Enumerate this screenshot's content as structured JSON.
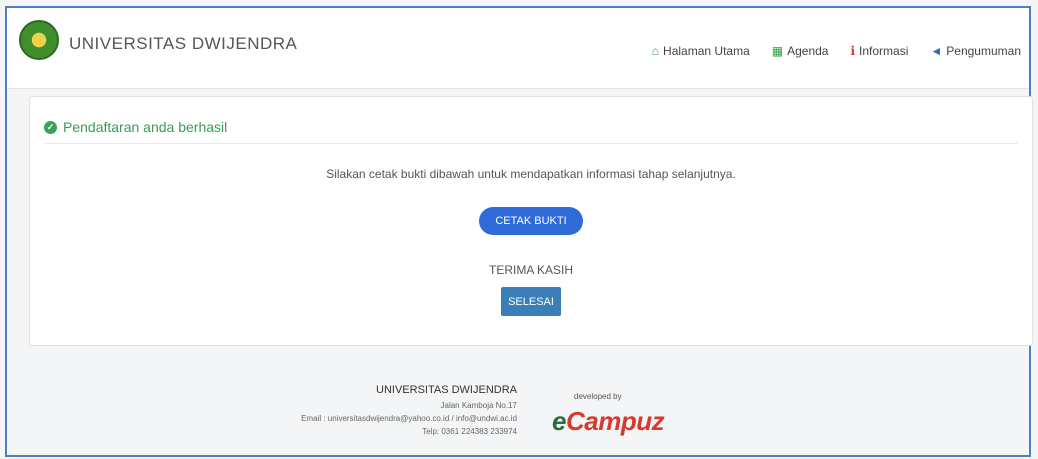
{
  "brand": {
    "name": "UNIVERSITAS DWIJENDRA",
    "logo_icon": "university-seal-icon"
  },
  "nav": {
    "items": [
      {
        "label": "Halaman Utama",
        "icon": "home-icon",
        "color": "#2e9e3b"
      },
      {
        "label": "Agenda",
        "icon": "calendar-icon",
        "color": "#2e9e3b"
      },
      {
        "label": "Informasi",
        "icon": "info-icon",
        "color": "#e0322c"
      },
      {
        "label": "Pengumuman",
        "icon": "megaphone-icon",
        "color": "#2f6fb5"
      }
    ]
  },
  "panel": {
    "title": "Pendaftaran anda berhasil",
    "message": "Silakan cetak bukti dibawah untuk mendapatkan informasi tahap selanjutnya.",
    "print_button": "CETAK BUKTI",
    "thanks": "TERIMA KASIH",
    "done_button": "SELESAI",
    "accent": "#3a9a5a"
  },
  "footer": {
    "name": "UNIVERSITAS DWIJENDRA",
    "address": "Jalan Kamboja No.17",
    "email": "Email : universitasdwijendra@yahoo.co.id / info@undwi.ac.id",
    "phone": "Telp: 0361 224383 233974",
    "developed_by": "developed by",
    "developer_e": "e",
    "developer_rest": "Campuz"
  }
}
